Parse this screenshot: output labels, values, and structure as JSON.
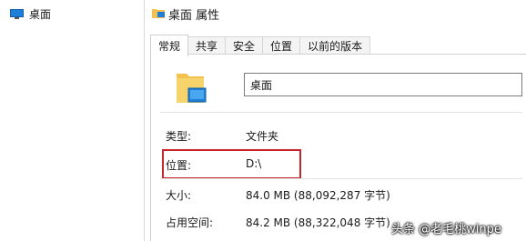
{
  "explorer": {
    "tree_item_label": "桌面"
  },
  "dialog": {
    "title": "桌面 属性",
    "tabs": [
      {
        "label": "常规",
        "active": true
      },
      {
        "label": "共享",
        "active": false
      },
      {
        "label": "安全",
        "active": false
      },
      {
        "label": "位置",
        "active": false
      },
      {
        "label": "以前的版本",
        "active": false
      }
    ],
    "name_value": "桌面",
    "properties": [
      {
        "label": "类型:",
        "value": "文件夹"
      },
      {
        "label": "位置:",
        "value": "D:\\"
      },
      {
        "label": "大小:",
        "value": "84.0 MB (88,092,287 字节)"
      },
      {
        "label": "占用空间:",
        "value": "84.2 MB (88,322,048 字节)"
      }
    ]
  },
  "watermark": "头条 @老毛桃winpe",
  "colors": {
    "highlight_box": "#c8262f",
    "folder_yellow": "#f2c14e",
    "desktop_blue": "#1e7fd8"
  },
  "icons": [
    "monitor-icon",
    "folder-desktop-icon"
  ]
}
